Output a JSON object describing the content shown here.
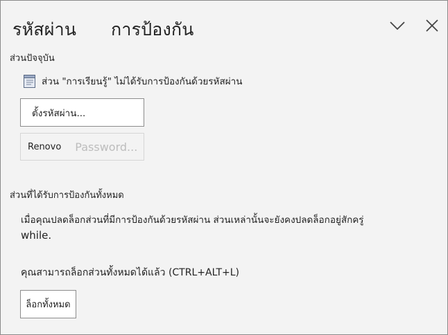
{
  "header": {
    "title_part1": "รหัสผ่าน",
    "title_part2": "การป้องกัน",
    "collapse_icon": "chevron-down-icon",
    "close_icon": "close-icon"
  },
  "current_section": {
    "label": "ส่วนปัจจุบัน",
    "status_text": "ส่วน \"การเรียนรู้\" ไม่ได้รับการป้องกันด้วยรหัสผ่าน",
    "set_password_button": "ตั้งรหัสผ่าน...",
    "change_password_button_part1": "Renovo",
    "change_password_button_part2": "Password..."
  },
  "all_protected": {
    "label": "ส่วนที่ได้รับการป้องกันทั้งหมด",
    "description_line1": "เมื่อคุณปลดล็อกส่วนที่มีการป้องกันด้วยรหัสผ่าน ส่วนเหล่านั้นจะยังคงปลดล็อกอยู่สักครู่",
    "description_line2": "while.",
    "shortcut_text": "คุณสามารถล็อกส่วนทั้งหมดได้แล้ว (CTRL+ALT+L)",
    "lock_all_button": "ล็อกทั้งหมด"
  }
}
